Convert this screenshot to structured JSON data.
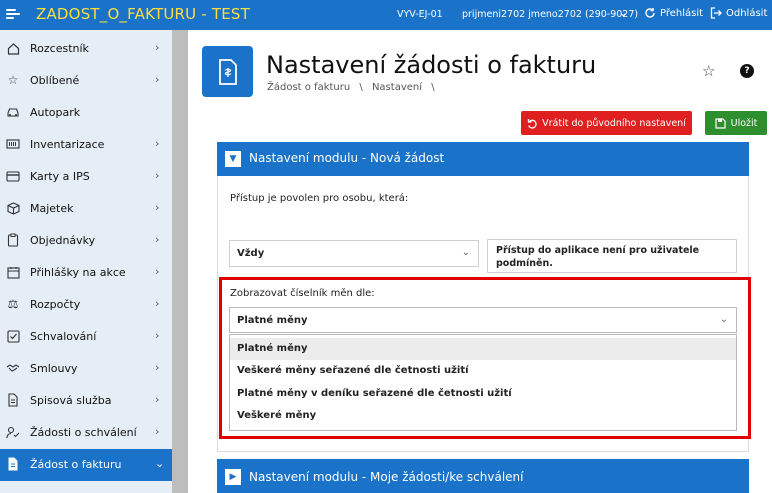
{
  "topbar": {
    "app_title": "ZADOST_O_FAKTURU - TEST",
    "environment": "VYV-EJ-01",
    "user": "prijmeni2702 jmeno2702 (290-9027)",
    "login_label": "Přehlásit",
    "logout_label": "Odhlásit"
  },
  "sidebar": {
    "items": [
      {
        "label": "Rozcestník",
        "icon": "home-icon"
      },
      {
        "label": "Oblíbené",
        "icon": "star-icon"
      },
      {
        "label": "Autopark",
        "icon": "car-icon"
      },
      {
        "label": "Inventarizace",
        "icon": "barcode-icon"
      },
      {
        "label": "Karty a IPS",
        "icon": "card-icon"
      },
      {
        "label": "Majetek",
        "icon": "box-icon"
      },
      {
        "label": "Objednávky",
        "icon": "clipboard-icon"
      },
      {
        "label": "Přihlášky na akce",
        "icon": "calendar-icon"
      },
      {
        "label": "Rozpočty",
        "icon": "scales-icon"
      },
      {
        "label": "Schvalování",
        "icon": "checkbox-icon"
      },
      {
        "label": "Smlouvy",
        "icon": "handshake-icon"
      },
      {
        "label": "Spisová služba",
        "icon": "folder-icon"
      },
      {
        "label": "Žádosti o schválení",
        "icon": "user-check-icon"
      },
      {
        "label": "Žádost o fakturu",
        "icon": "invoice-icon",
        "active": true
      }
    ]
  },
  "page": {
    "title": "Nastavení žádosti o fakturu",
    "breadcrumb": [
      "Žádost o fakturu",
      "\\",
      "Nastavení",
      "\\"
    ]
  },
  "toolbar": {
    "reset_label": "Vrátit do původního nastavení",
    "save_label": "Uložit"
  },
  "panel1": {
    "title": "Nastavení modulu - Nová žádost",
    "access_text": "Přístup je povolen pro osobu, která:",
    "access_select_value": "Vždy",
    "access_info": "Přístup do aplikace není pro uživatele podmíněn.",
    "currency_label": "Zobrazovat číselník měn dle:",
    "currency_select_value": "Platné měny",
    "currency_options": [
      "Platné měny",
      "Veškeré měny seřazené dle četnosti užití",
      "Platné měny v deníku seřazené dle četnosti užití",
      "Veškeré měny"
    ]
  },
  "panel2": {
    "title": "Nastavení modulu - Moje žádosti/ke schválení"
  },
  "colors": {
    "brand_blue": "#1a73c8",
    "title_yellow": "#ffde3a",
    "danger": "#e02020",
    "success": "#2e8f2e",
    "highlight": "#e00000"
  }
}
